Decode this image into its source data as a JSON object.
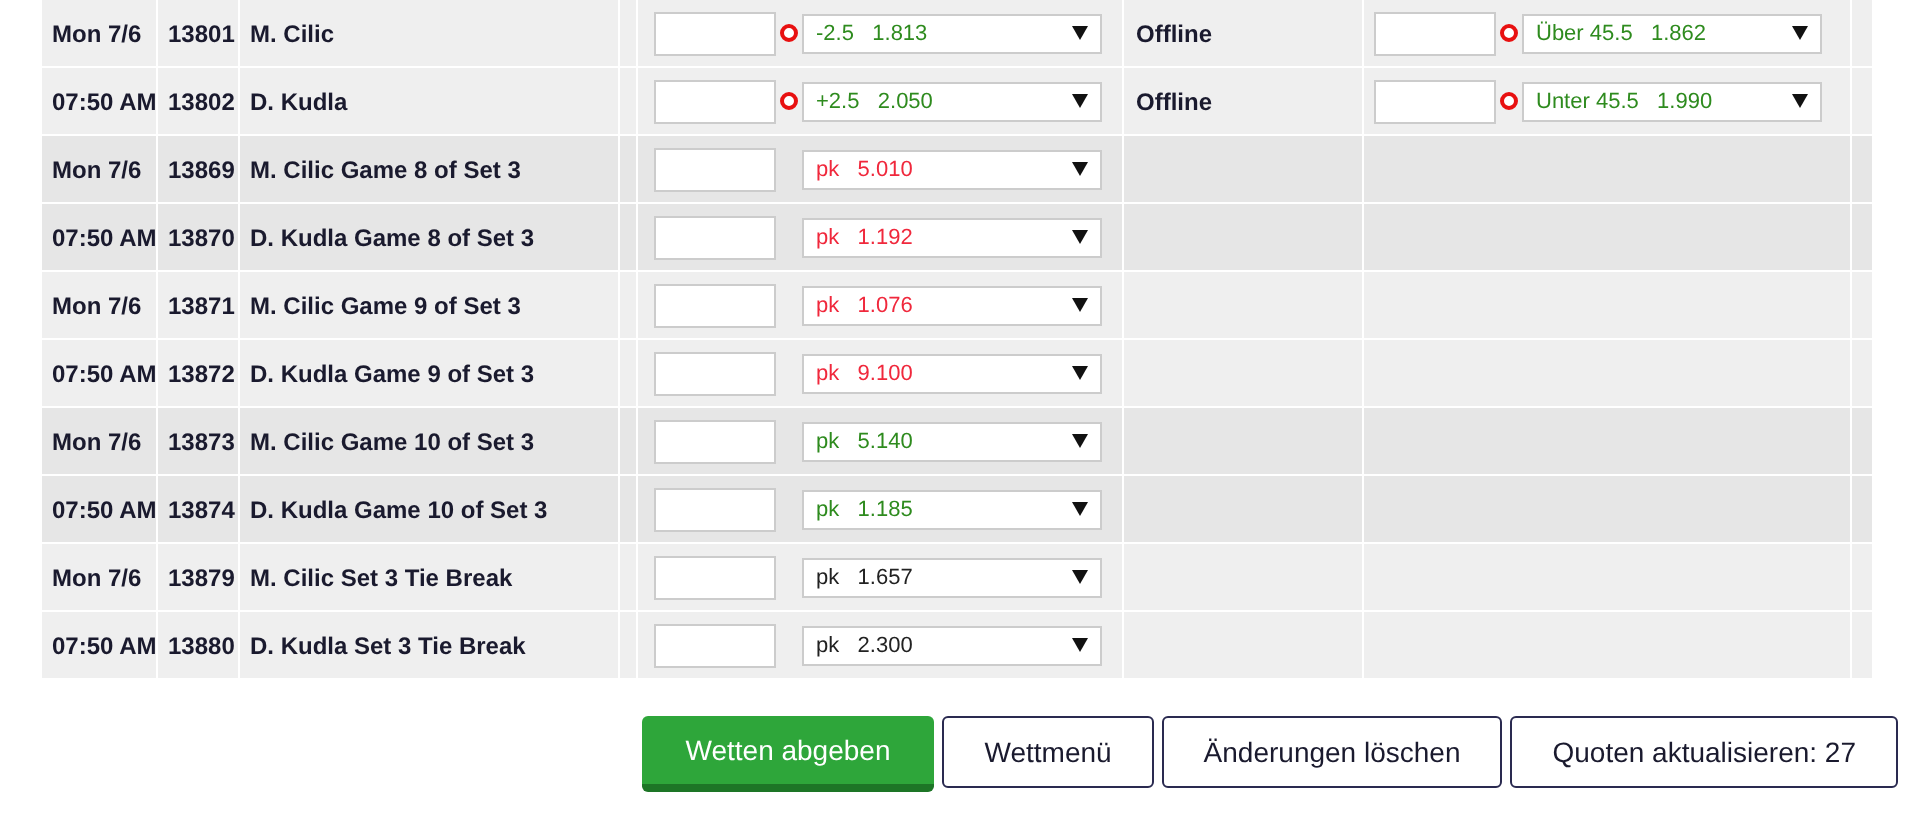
{
  "rows": [
    {
      "date": "Mon 7/6",
      "id": "13801",
      "name": "M. Cilic",
      "alert": true,
      "odds": {
        "line": "-2.5",
        "price": "1.813",
        "color": "#2e8b1e"
      },
      "total": {
        "status": "Offline",
        "alert": true,
        "odds": {
          "line": "Über 45.5",
          "price": "1.862",
          "color": "#2e8b1e"
        }
      }
    },
    {
      "date": "07:50 AM",
      "id": "13802",
      "name": "D. Kudla",
      "alert": true,
      "odds": {
        "line": "+2.5",
        "price": "2.050",
        "color": "#2e8b1e"
      },
      "total": {
        "status": "Offline",
        "alert": true,
        "odds": {
          "line": "Unter 45.5",
          "price": "1.990",
          "color": "#2e8b1e"
        }
      }
    },
    {
      "date": "Mon 7/6",
      "id": "13869",
      "name": "M. Cilic Game 8 of Set 3",
      "alert": false,
      "odds": {
        "line": "pk",
        "price": "5.010",
        "color": "#f0283c"
      }
    },
    {
      "date": "07:50 AM",
      "id": "13870",
      "name": "D. Kudla Game 8 of Set 3",
      "alert": false,
      "odds": {
        "line": "pk",
        "price": "1.192",
        "color": "#f0283c"
      }
    },
    {
      "date": "Mon 7/6",
      "id": "13871",
      "name": "M. Cilic Game 9 of Set 3",
      "alert": false,
      "odds": {
        "line": "pk",
        "price": "1.076",
        "color": "#f0283c"
      }
    },
    {
      "date": "07:50 AM",
      "id": "13872",
      "name": "D. Kudla Game 9 of Set 3",
      "alert": false,
      "odds": {
        "line": "pk",
        "price": "9.100",
        "color": "#f0283c"
      }
    },
    {
      "date": "Mon 7/6",
      "id": "13873",
      "name": "M. Cilic Game 10 of Set 3",
      "alert": false,
      "odds": {
        "line": "pk",
        "price": "5.140",
        "color": "#2e8b1e"
      }
    },
    {
      "date": "07:50 AM",
      "id": "13874",
      "name": "D. Kudla Game 10 of Set 3",
      "alert": false,
      "odds": {
        "line": "pk",
        "price": "1.185",
        "color": "#2e8b1e"
      }
    },
    {
      "date": "Mon 7/6",
      "id": "13879",
      "name": "M. Cilic Set 3 Tie Break",
      "alert": false,
      "odds": {
        "line": "pk",
        "price": "1.657",
        "color": "#222222"
      }
    },
    {
      "date": "07:50 AM",
      "id": "13880",
      "name": "D. Kudla Set 3 Tie Break",
      "alert": false,
      "odds": {
        "line": "pk",
        "price": "2.300",
        "color": "#222222"
      }
    }
  ],
  "buttons": [
    {
      "label": "Wetten abgeben",
      "kind": "primary"
    },
    {
      "label": "Wettmenü",
      "kind": "secondary"
    },
    {
      "label": "Änderungen löschen",
      "kind": "secondary"
    },
    {
      "label": "Quoten aktualisieren: 27",
      "kind": "secondary"
    }
  ]
}
